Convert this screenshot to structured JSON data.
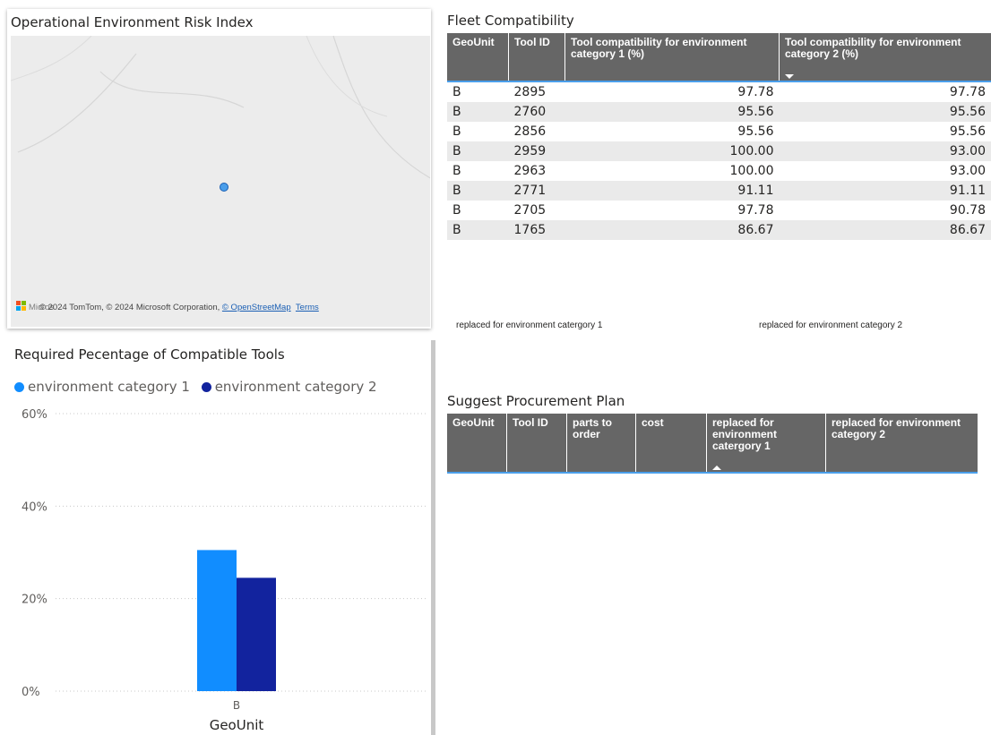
{
  "map": {
    "title": "Operational Environment Risk Index",
    "logo_text": "Micros",
    "attribution_prefix": "© 2024 TomTom, © 2024 Microsoft Corporation, ",
    "link_osm": "© OpenStreetMap",
    "link_terms": "Terms"
  },
  "fleet": {
    "title": "Fleet Compatibility",
    "columns": [
      "GeoUnit",
      "Tool ID",
      "Tool compatibility for environment category 1 (%)",
      "Tool compatibility for environment category 2 (%)"
    ],
    "rows": [
      [
        "B",
        "2895",
        "97.78",
        "97.78"
      ],
      [
        "B",
        "2760",
        "95.56",
        "95.56"
      ],
      [
        "B",
        "2856",
        "95.56",
        "95.56"
      ],
      [
        "B",
        "2959",
        "100.00",
        "93.00"
      ],
      [
        "B",
        "2963",
        "100.00",
        "93.00"
      ],
      [
        "B",
        "2771",
        "91.11",
        "91.11"
      ],
      [
        "B",
        "2705",
        "97.78",
        "90.78"
      ],
      [
        "B",
        "1765",
        "86.67",
        "86.67"
      ]
    ]
  },
  "cards": {
    "label1": "replaced for environment catergory 1",
    "label2": "replaced for environment category 2"
  },
  "plan": {
    "title": "Suggest Procurement Plan",
    "columns": [
      "GeoUnit",
      "Tool ID",
      "parts to order",
      "cost",
      "replaced for environment catergory 1",
      "replaced for environment category 2"
    ]
  },
  "chart": {
    "title": "Required Pecentage of Compatible Tools"
  },
  "chart_data": {
    "type": "bar",
    "categories": [
      "B"
    ],
    "series": [
      {
        "name": "environment category 1",
        "values": [
          30.5
        ],
        "color": "#118dff"
      },
      {
        "name": "environment category 2",
        "values": [
          24.5
        ],
        "color": "#12239e"
      }
    ],
    "xlabel": "GeoUnit",
    "ylabel": "",
    "ylim": [
      0,
      60
    ],
    "yticks": [
      "0%",
      "20%",
      "40%",
      "60%"
    ],
    "ytick_values": [
      0,
      20,
      40,
      60
    ],
    "grid": true,
    "legend": "top-left"
  }
}
